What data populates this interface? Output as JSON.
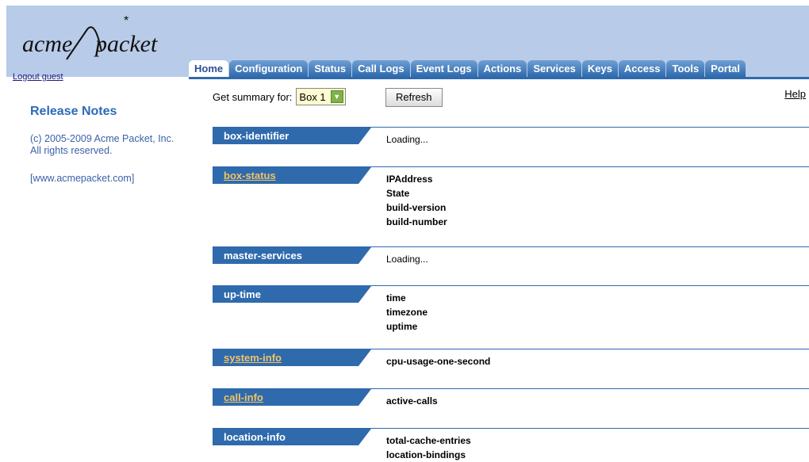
{
  "header": {
    "logo_text_left": "acme",
    "logo_text_right": "packet",
    "logout_label": "Logout guest"
  },
  "tabs": [
    {
      "label": "Home",
      "active": true
    },
    {
      "label": "Configuration"
    },
    {
      "label": "Status"
    },
    {
      "label": "Call Logs"
    },
    {
      "label": "Event Logs"
    },
    {
      "label": "Actions"
    },
    {
      "label": "Services"
    },
    {
      "label": "Keys"
    },
    {
      "label": "Access"
    },
    {
      "label": "Tools"
    },
    {
      "label": "Portal"
    }
  ],
  "sidebar": {
    "title": "Release Notes",
    "copyright": "(c) 2005-2009 Acme Packet, Inc. All rights reserved.",
    "website": "[www.acmepacket.com]"
  },
  "summary": {
    "label": "Get summary for:",
    "selected": "Box 1",
    "refresh_label": "Refresh",
    "help_label": "Help"
  },
  "sections": [
    {
      "name": "box-identifier",
      "link": false,
      "values": [
        "Loading..."
      ],
      "bold": false
    },
    {
      "name": "box-status",
      "link": true,
      "values": [
        "IPAddress",
        "State",
        "build-version",
        "build-number"
      ],
      "bold": true
    },
    {
      "name": "master-services",
      "link": false,
      "values": [
        "Loading..."
      ],
      "bold": false
    },
    {
      "name": "up-time",
      "link": false,
      "values": [
        "time",
        "timezone",
        "uptime"
      ],
      "bold": true
    },
    {
      "name": "system-info",
      "link": true,
      "values": [
        "cpu-usage-one-second"
      ],
      "bold": true
    },
    {
      "name": "call-info",
      "link": true,
      "values": [
        "active-calls"
      ],
      "bold": true
    },
    {
      "name": "location-info",
      "link": false,
      "values": [
        "total-cache-entries",
        "location-bindings"
      ],
      "bold": true
    }
  ],
  "colors": {
    "header_bg": "#b8cbe8",
    "tab_blue": "#2f6aad",
    "link_gold": "#f2c463",
    "sidebar_text": "#3a62a8"
  }
}
